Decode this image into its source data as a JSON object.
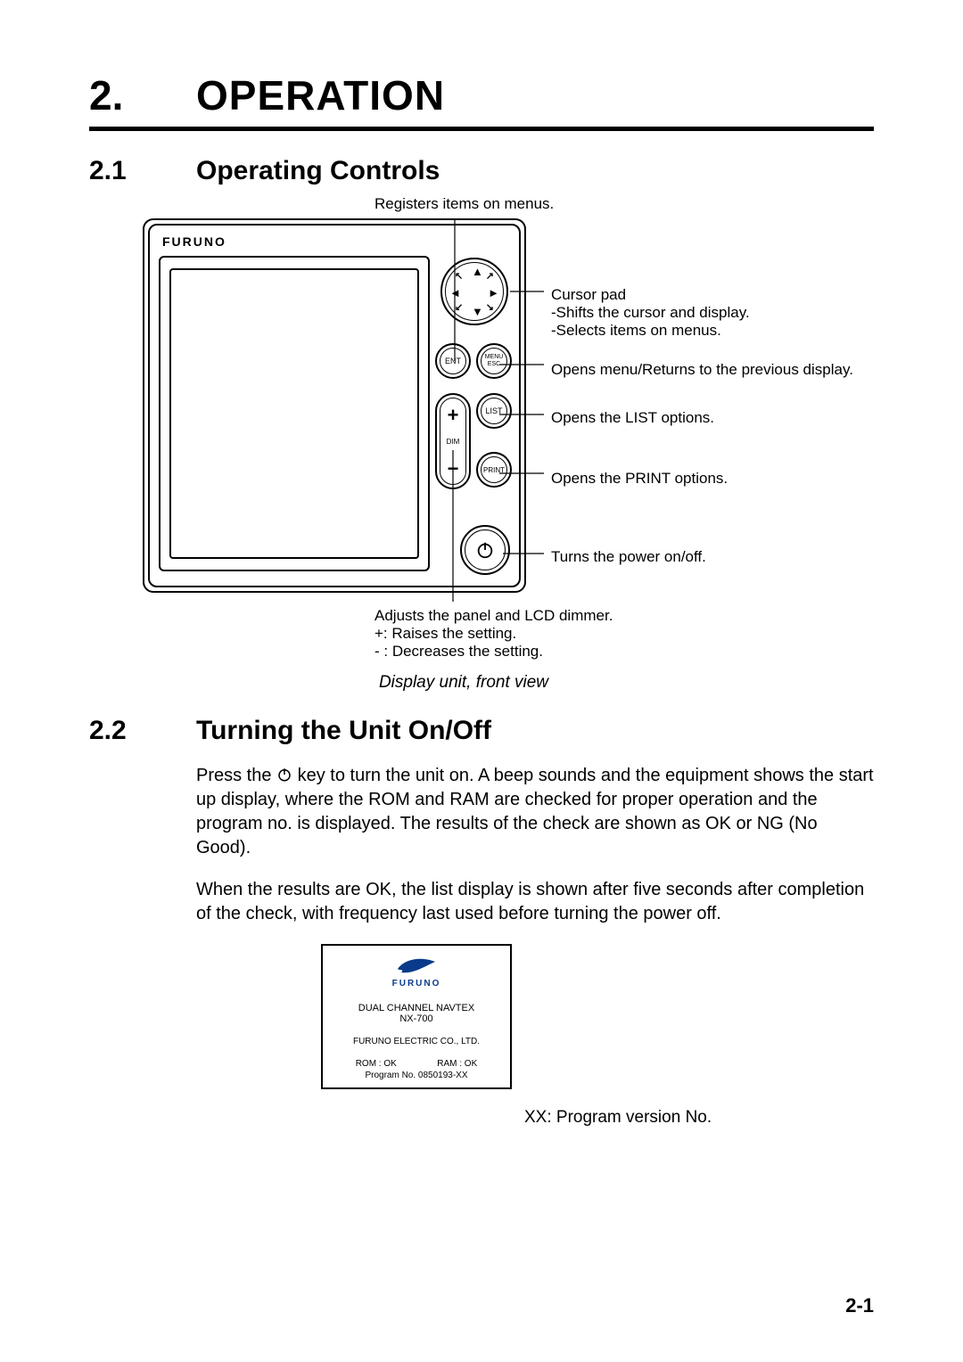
{
  "chapter": {
    "num": "2.",
    "title": "OPERATION"
  },
  "section1": {
    "num": "2.1",
    "title": "Operating Controls"
  },
  "section2": {
    "num": "2.2",
    "title": "Turning the Unit On/Off"
  },
  "panel": {
    "brand": "FURUNO",
    "ent_label": "ENT",
    "menu_label_top": "MENU",
    "menu_label_bot": "ESC",
    "dim_label": "DIM",
    "list_label": "LIST",
    "print_label": "PRINT"
  },
  "callouts": {
    "top": "Registers items on menus.",
    "cursor_title": "Cursor pad",
    "cursor_l1": "-Shifts the cursor and display.",
    "cursor_l2": "-Selects items on menus.",
    "menu": "Opens menu/Returns to the previous display.",
    "list": "Opens the LIST options.",
    "print": "Opens the PRINT options.",
    "power": "Turns the power on/off.",
    "bottom_l1": "Adjusts the panel and LCD dimmer.",
    "bottom_l2": "+: Raises the setting.",
    "bottom_l3": "- : Decreases the setting."
  },
  "fig_caption": "Display unit, front view",
  "body": {
    "p1_a": "Press the ",
    "p1_b": " key to turn the unit on. A beep sounds and the equipment shows the start up display, where the ROM and RAM are checked for proper operation and the program no. is displayed. The results of the check are shown as OK or NG (No Good).",
    "p2": "When the results are OK, the list display is shown after five seconds after completion of the check, with frequency last used before turning the power off."
  },
  "startup": {
    "brand": "FURUNO",
    "title_l1": "DUAL CHANNEL NAVTEX",
    "title_l2": "NX-700",
    "company": "FURUNO ELECTRIC CO., LTD.",
    "rom": "ROM : OK",
    "ram": "RAM : OK",
    "prog": "Program No.  0850193-XX",
    "note": "XX: Program version No."
  },
  "page_number": "2-1"
}
